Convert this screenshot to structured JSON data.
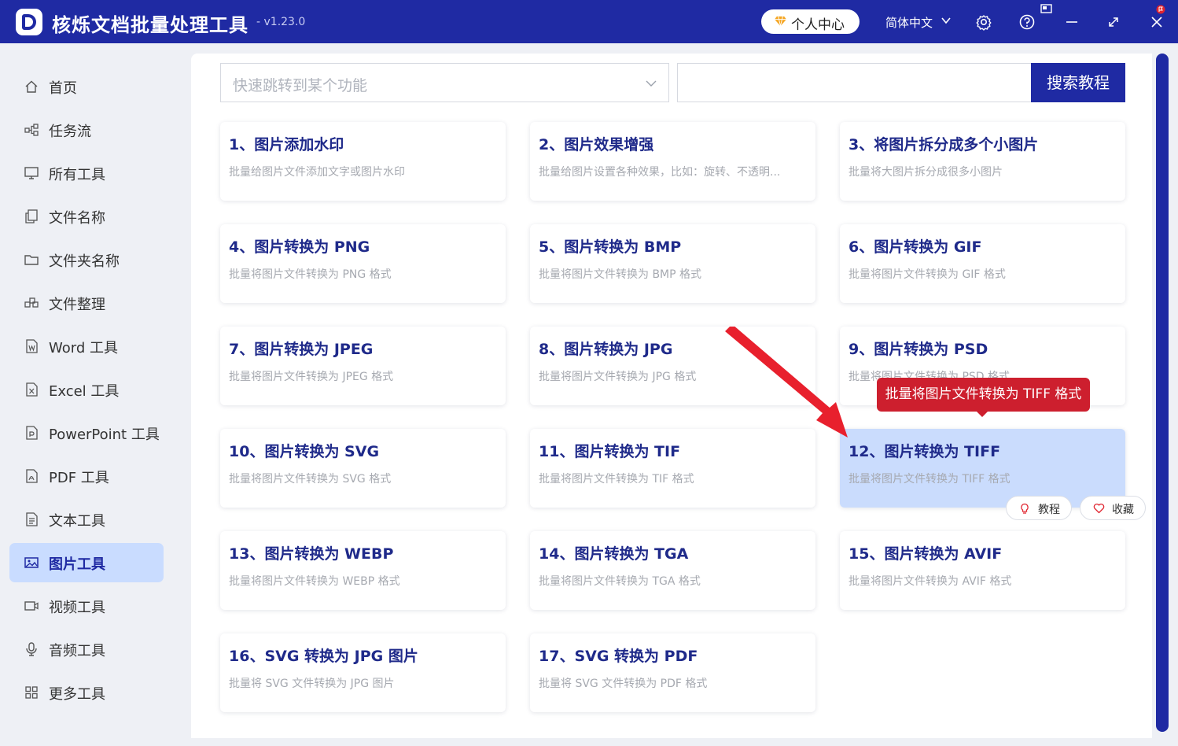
{
  "app": {
    "title": "核烁文档批量处理工具",
    "version": "- v1.23.0",
    "personal_center": "个人中心",
    "language": "简体中文",
    "colors": {
      "primary": "#1f2aa3",
      "highlight": "#cadcfd",
      "tooltip": "#cd1f2e"
    }
  },
  "sidebar": {
    "items": [
      {
        "label": "首页",
        "icon": "home-icon"
      },
      {
        "label": "任务流",
        "icon": "workflow-icon"
      },
      {
        "label": "所有工具",
        "icon": "monitor-icon"
      },
      {
        "label": "文件名称",
        "icon": "file-copy-icon"
      },
      {
        "label": "文件夹名称",
        "icon": "folder-icon"
      },
      {
        "label": "文件整理",
        "icon": "organize-icon"
      },
      {
        "label": "Word 工具",
        "icon": "word-icon"
      },
      {
        "label": "Excel 工具",
        "icon": "excel-icon"
      },
      {
        "label": "PowerPoint 工具",
        "icon": "powerpoint-icon"
      },
      {
        "label": "PDF 工具",
        "icon": "pdf-icon"
      },
      {
        "label": "文本工具",
        "icon": "text-icon"
      },
      {
        "label": "图片工具",
        "icon": "image-icon",
        "active": true
      },
      {
        "label": "视频工具",
        "icon": "video-icon"
      },
      {
        "label": "音频工具",
        "icon": "microphone-icon"
      },
      {
        "label": "更多工具",
        "icon": "grid-icon"
      }
    ]
  },
  "search": {
    "placeholder": "快速跳转到某个功能",
    "button": "搜索教程"
  },
  "cards": [
    {
      "title": "1、图片添加水印",
      "desc": "批量给图片文件添加文字或图片水印"
    },
    {
      "title": "2、图片效果增强",
      "desc": "批量给图片设置各种效果，比如：旋转、不透明..."
    },
    {
      "title": "3、将图片拆分成多个小图片",
      "desc": "批量将大图片拆分成很多小图片"
    },
    {
      "title": "4、图片转换为 PNG",
      "desc": "批量将图片文件转换为 PNG 格式"
    },
    {
      "title": "5、图片转换为 BMP",
      "desc": "批量将图片文件转换为 BMP 格式"
    },
    {
      "title": "6、图片转换为 GIF",
      "desc": "批量将图片文件转换为 GIF 格式"
    },
    {
      "title": "7、图片转换为 JPEG",
      "desc": "批量将图片文件转换为 JPEG 格式"
    },
    {
      "title": "8、图片转换为 JPG",
      "desc": "批量将图片文件转换为 JPG 格式"
    },
    {
      "title": "9、图片转换为 PSD",
      "desc": "批量将图片文件转换为 PSD 格式"
    },
    {
      "title": "10、图片转换为 SVG",
      "desc": "批量将图片文件转换为 SVG 格式"
    },
    {
      "title": "11、图片转换为 TIF",
      "desc": "批量将图片文件转换为 TIF 格式"
    },
    {
      "title": "12、图片转换为 TIFF",
      "desc": "批量将图片文件转换为 TIFF 格式",
      "highlighted": true
    },
    {
      "title": "13、图片转换为 WEBP",
      "desc": "批量将图片文件转换为 WEBP 格式"
    },
    {
      "title": "14、图片转换为 TGA",
      "desc": "批量将图片文件转换为 TGA 格式"
    },
    {
      "title": "15、图片转换为 AVIF",
      "desc": "批量将图片文件转换为 AVIF 格式"
    },
    {
      "title": "16、SVG 转换为 JPG 图片",
      "desc": "批量将 SVG 文件转换为 JPG 图片"
    },
    {
      "title": "17、SVG 转换为 PDF",
      "desc": "批量将 SVG 文件转换为 PDF 格式"
    }
  ],
  "card_actions": {
    "tutorial": "教程",
    "favorite": "收藏"
  },
  "tooltip": {
    "text": "批量将图片文件转换为 TIFF 格式"
  }
}
